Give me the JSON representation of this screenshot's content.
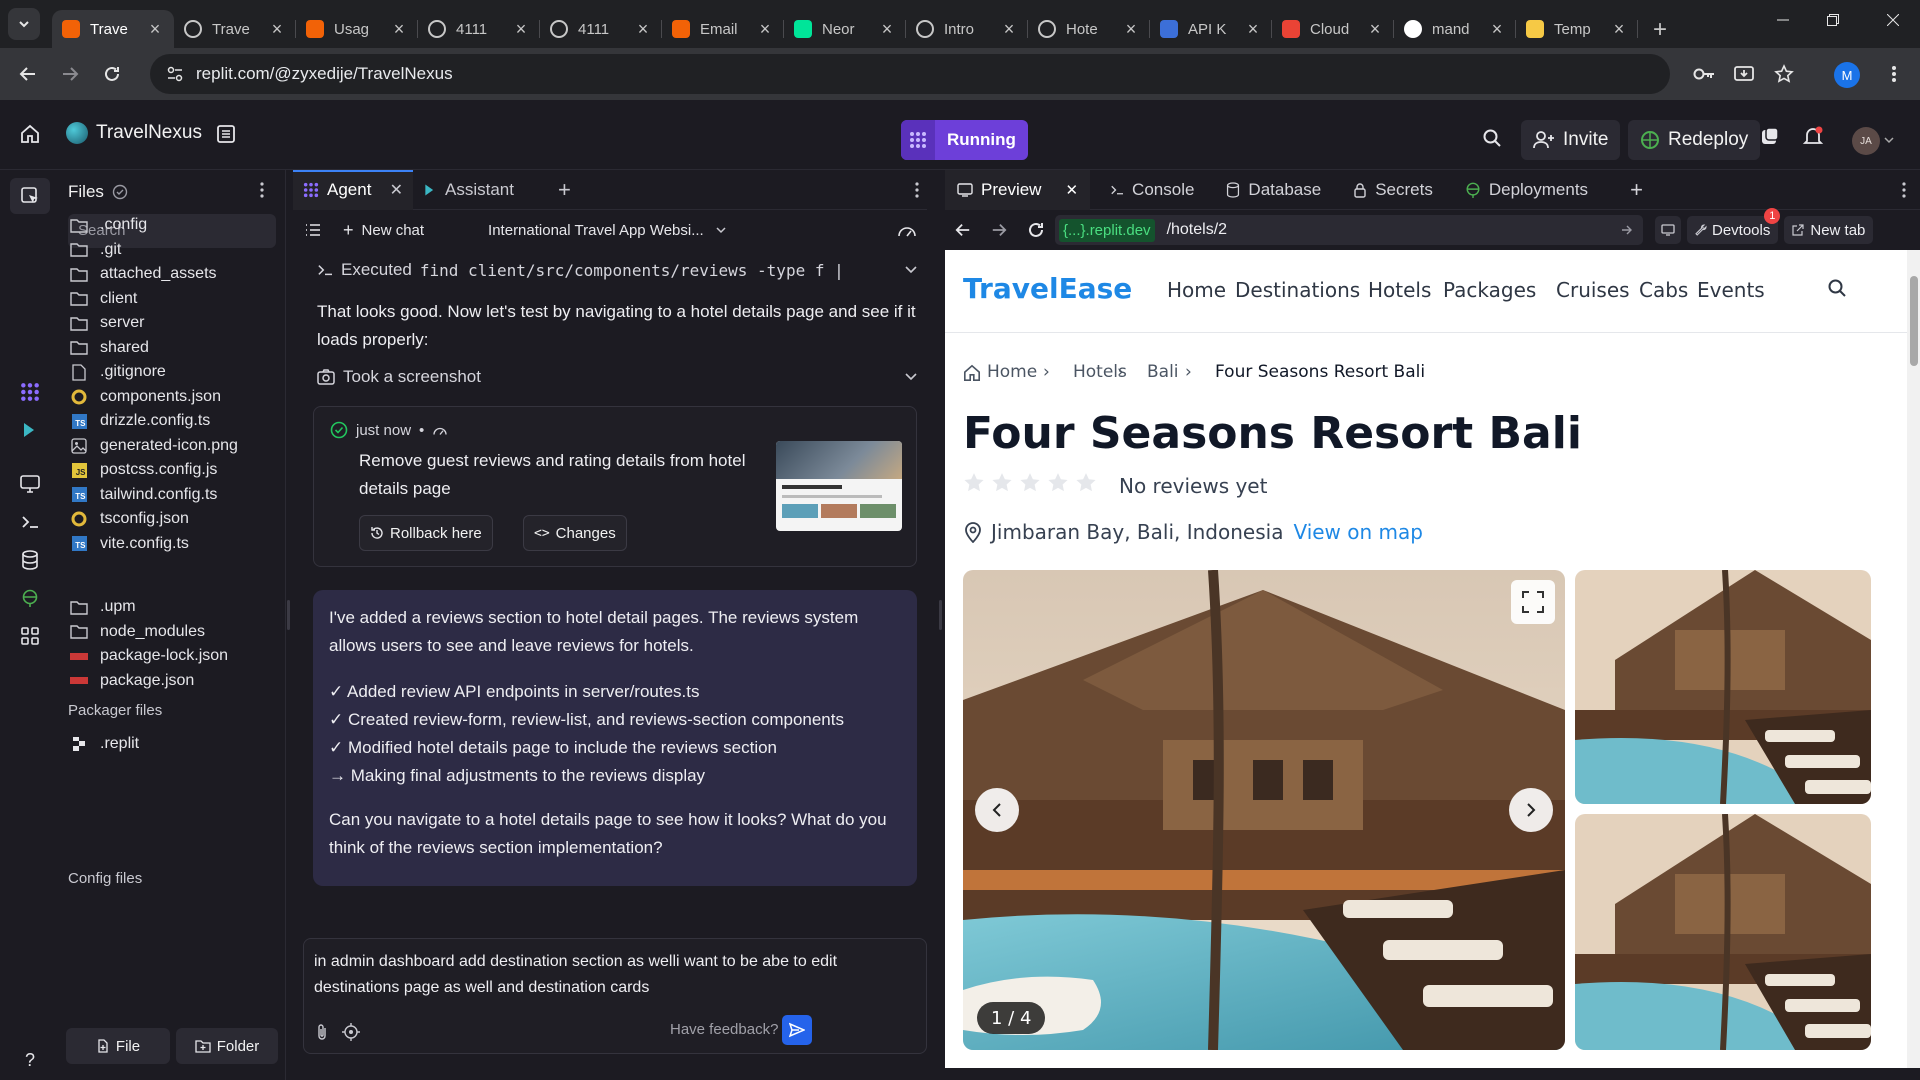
{
  "browser": {
    "tabs": [
      {
        "title": "Trave",
        "fav": "replit",
        "active": true
      },
      {
        "title": "Trave",
        "fav": "globe"
      },
      {
        "title": "Usag",
        "fav": "replit-orange"
      },
      {
        "title": "4111",
        "fav": "globe"
      },
      {
        "title": "4111",
        "fav": "globe"
      },
      {
        "title": "Email",
        "fav": "replit-orange"
      },
      {
        "title": "Neor",
        "fav": "neon"
      },
      {
        "title": "Intro",
        "fav": "openai"
      },
      {
        "title": "Hote",
        "fav": "openai"
      },
      {
        "title": "API K",
        "fav": "api"
      },
      {
        "title": "Cloud",
        "fav": "gmail"
      },
      {
        "title": "mand",
        "fav": "google"
      },
      {
        "title": "Temp",
        "fav": "mail"
      }
    ],
    "url": "replit.com/@zyxedije/TravelNexus",
    "profile_initial": "M"
  },
  "replit": {
    "project_name": "TravelNexus",
    "run_label": "Running",
    "invite_label": "Invite",
    "redeploy_label": "Redeploy",
    "avatar_initials": "JA"
  },
  "files": {
    "title": "Files",
    "search_placeholder": "Search",
    "items": [
      {
        "name": ".config",
        "type": "folder"
      },
      {
        "name": ".git",
        "type": "folder"
      },
      {
        "name": "attached_assets",
        "type": "folder"
      },
      {
        "name": "client",
        "type": "folder"
      },
      {
        "name": "server",
        "type": "folder"
      },
      {
        "name": "shared",
        "type": "folder"
      },
      {
        "name": ".gitignore",
        "type": "file"
      },
      {
        "name": "components.json",
        "type": "json"
      },
      {
        "name": "drizzle.config.ts",
        "type": "ts"
      },
      {
        "name": "generated-icon.png",
        "type": "image"
      },
      {
        "name": "postcss.config.js",
        "type": "js"
      },
      {
        "name": "tailwind.config.ts",
        "type": "ts"
      },
      {
        "name": "tsconfig.json",
        "type": "json"
      },
      {
        "name": "vite.config.ts",
        "type": "ts"
      }
    ],
    "packager_title": "Packager files",
    "packager_items": [
      {
        "name": ".upm",
        "type": "folder"
      },
      {
        "name": "node_modules",
        "type": "folder"
      },
      {
        "name": "package-lock.json",
        "type": "npm"
      },
      {
        "name": "package.json",
        "type": "npm"
      }
    ],
    "config_title": "Config files",
    "config_items": [
      {
        "name": ".replit",
        "type": "replit"
      }
    ],
    "new_file_label": "File",
    "new_folder_label": "Folder"
  },
  "agent": {
    "tab_agent": "Agent",
    "tab_assistant": "Assistant",
    "new_chat": "New chat",
    "chat_title": "International Travel App Websi...",
    "executed": "Executed",
    "executed_cmd": "find client/src/components/reviews -type f | ...",
    "message1": "That looks good. Now let's test by navigating to a hotel details page and see if it loads properly:",
    "took_screenshot": "Took a screenshot",
    "checkpoint_time": "just now",
    "checkpoint_text": "Remove guest reviews and rating details from hotel details page",
    "rollback_label": "Rollback here",
    "changes_label": "Changes",
    "summary_intro": "I've added a reviews section to hotel detail pages. The reviews system allows users to see and leave reviews for hotels.",
    "summary_items": [
      "✓ Added review API endpoints in server/routes.ts",
      "✓ Created review-form, review-list, and reviews-section components",
      "✓ Modified hotel details page to include the reviews section",
      "→ Making final adjustments to the reviews display"
    ],
    "summary_question": "Can you navigate to a hotel details page to see how it looks? What do you think of the reviews section implementation?",
    "input_text": "in admin dashboard add destination section as welli want to be abe to edit destinations page as well and destination cards",
    "feedback_label": "Have feedback?"
  },
  "preview": {
    "tabs": [
      "Preview",
      "Console",
      "Database",
      "Secrets",
      "Deployments"
    ],
    "domain": "{...}.replit.dev",
    "path": "/hotels/2",
    "devtools_label": "Devtools",
    "devtools_badge": "1",
    "new_tab_label": "New tab"
  },
  "site": {
    "logo": "TravelEase",
    "nav": [
      "Home",
      "Destinations",
      "Hotels",
      "Packages",
      "Cruises",
      "Cabs",
      "Events"
    ],
    "breadcrumb": [
      "Home",
      "Hotels",
      "Bali",
      "Four Seasons Resort Bali"
    ],
    "hotel_name": "Four Seasons Resort Bali",
    "rating_stars": 0,
    "reviews_text": "No reviews yet",
    "location": "Jimbaran Bay, Bali, Indonesia",
    "map_link": "View on map",
    "gallery_counter": "1 / 4",
    "accent": "#1e88e5"
  }
}
